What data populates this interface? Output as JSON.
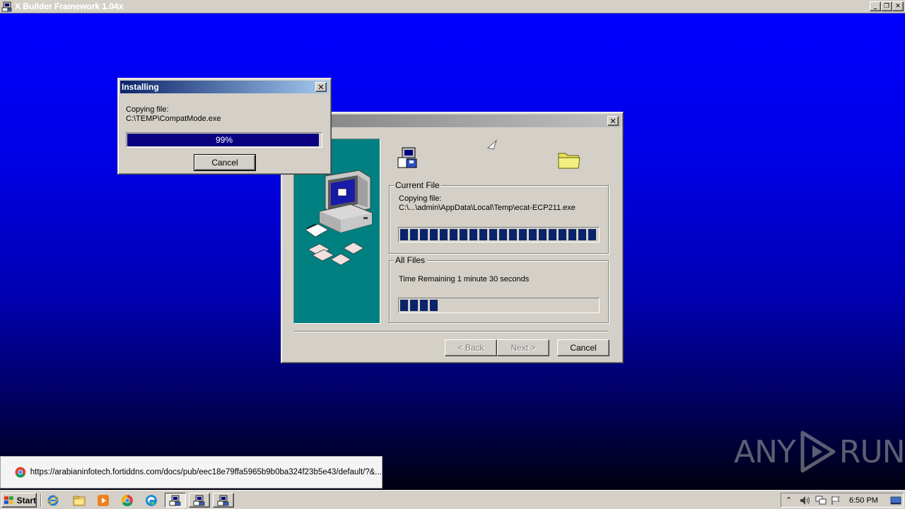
{
  "main_window": {
    "title": "X Builder Framework 1.04x",
    "minimize": "_",
    "restore": "❐",
    "close": "✕"
  },
  "setup_window": {
    "close": "✕",
    "current_file": {
      "legend": "Current File",
      "line1": "Copying file:",
      "line2": "C:\\...\\admin\\AppData\\Local\\Temp\\ecat-ECP211.exe",
      "progress": 1.0
    },
    "all_files": {
      "legend": "All Files",
      "time_remaining": "Time Remaining 1 minute  30 seconds",
      "progress": 0.2
    },
    "buttons": {
      "back": "< Back",
      "next": "Next >",
      "cancel": "Cancel"
    }
  },
  "installing_dialog": {
    "title": "Installing",
    "close": "✕",
    "line1": "Copying file:",
    "line2": "C:\\TEMP\\CompatMode.exe",
    "percent_text": "99%",
    "progress": 0.99,
    "cancel": "Cancel"
  },
  "notification": {
    "url": "https://arabianinfotech.fortiddns.com/docs/pub/eec18e79ffa5965b9b0ba324f23b5e43/default/?&..."
  },
  "watermark": {
    "text1": "ANY",
    "text2": "RUN"
  },
  "taskbar": {
    "start_label": "Start",
    "clock": "6:50 PM",
    "tray_arrow": "⌃"
  },
  "colors": {
    "title_active": "#0a246a",
    "progress": "#0a246a",
    "desktop_top": "#0000ff",
    "panel_teal": "#008080"
  }
}
